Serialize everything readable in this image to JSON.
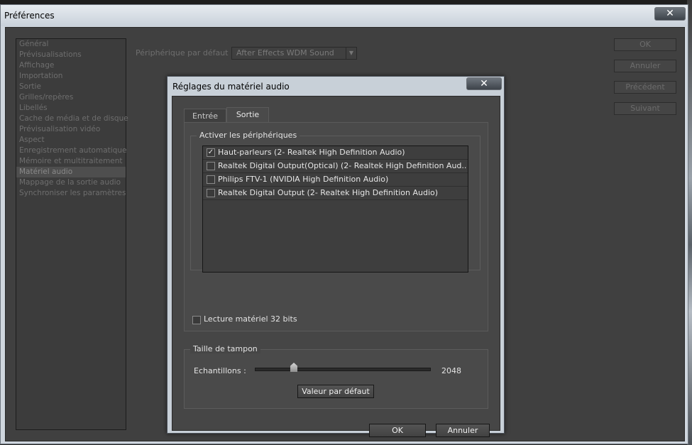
{
  "window": {
    "title": "Préférences",
    "close_glyph": "✕"
  },
  "sidebar": {
    "items": [
      {
        "label": "Général"
      },
      {
        "label": "Prévisualisations"
      },
      {
        "label": "Affichage"
      },
      {
        "label": "Importation"
      },
      {
        "label": "Sortie"
      },
      {
        "label": "Grilles/repères"
      },
      {
        "label": "Libellés"
      },
      {
        "label": "Cache de média et de disque"
      },
      {
        "label": "Prévisualisation vidéo"
      },
      {
        "label": "Aspect"
      },
      {
        "label": "Enregistrement automatique"
      },
      {
        "label": "Mémoire et multitraitement"
      },
      {
        "label": "Matériel audio",
        "selected": true
      },
      {
        "label": "Mappage de la sortie audio"
      },
      {
        "label": "Synchroniser les paramètres"
      }
    ]
  },
  "default_device": {
    "label": "Périphérique par défaut :",
    "value": "After Effects WDM Sound",
    "arrow_glyph": "▼"
  },
  "right_buttons": {
    "ok": "OK",
    "cancel": "Annuler",
    "previous": "Précédent",
    "next": "Suivant"
  },
  "dialog": {
    "title": "Réglages du matériel audio",
    "close_glyph": "✕",
    "tabs": {
      "input": "Entrée",
      "output": "Sortie",
      "active": "output"
    },
    "enable_devices": {
      "legend": "Activer les périphériques",
      "devices": [
        {
          "label": "Haut-parleurs (2- Realtek High Definition Audio)",
          "checked": true,
          "check_glyph": "✓"
        },
        {
          "label": "Realtek Digital Output(Optical) (2- Realtek High Definition Aud..",
          "checked": false,
          "check_glyph": ""
        },
        {
          "label": "Philips FTV-1 (NVIDIA High Definition Audio)",
          "checked": false,
          "check_glyph": ""
        },
        {
          "label": "Realtek Digital Output (2- Realtek High Definition Audio)",
          "checked": false,
          "check_glyph": ""
        }
      ]
    },
    "hardware_32bit": {
      "label": "Lecture matériel 32 bits",
      "checked": false
    },
    "buffer": {
      "legend": "Taille de tampon",
      "samples_label": "Echantillons :",
      "samples_value": "2048",
      "default_button": "Valeur par défaut"
    },
    "ok_button": "OK",
    "cancel_button": "Annuler"
  },
  "colors": {
    "panel_bg": "#404040",
    "title_bar": "#cfd6de",
    "text_light": "#e4e4e4",
    "text_disabled": "#6e6e6e"
  }
}
